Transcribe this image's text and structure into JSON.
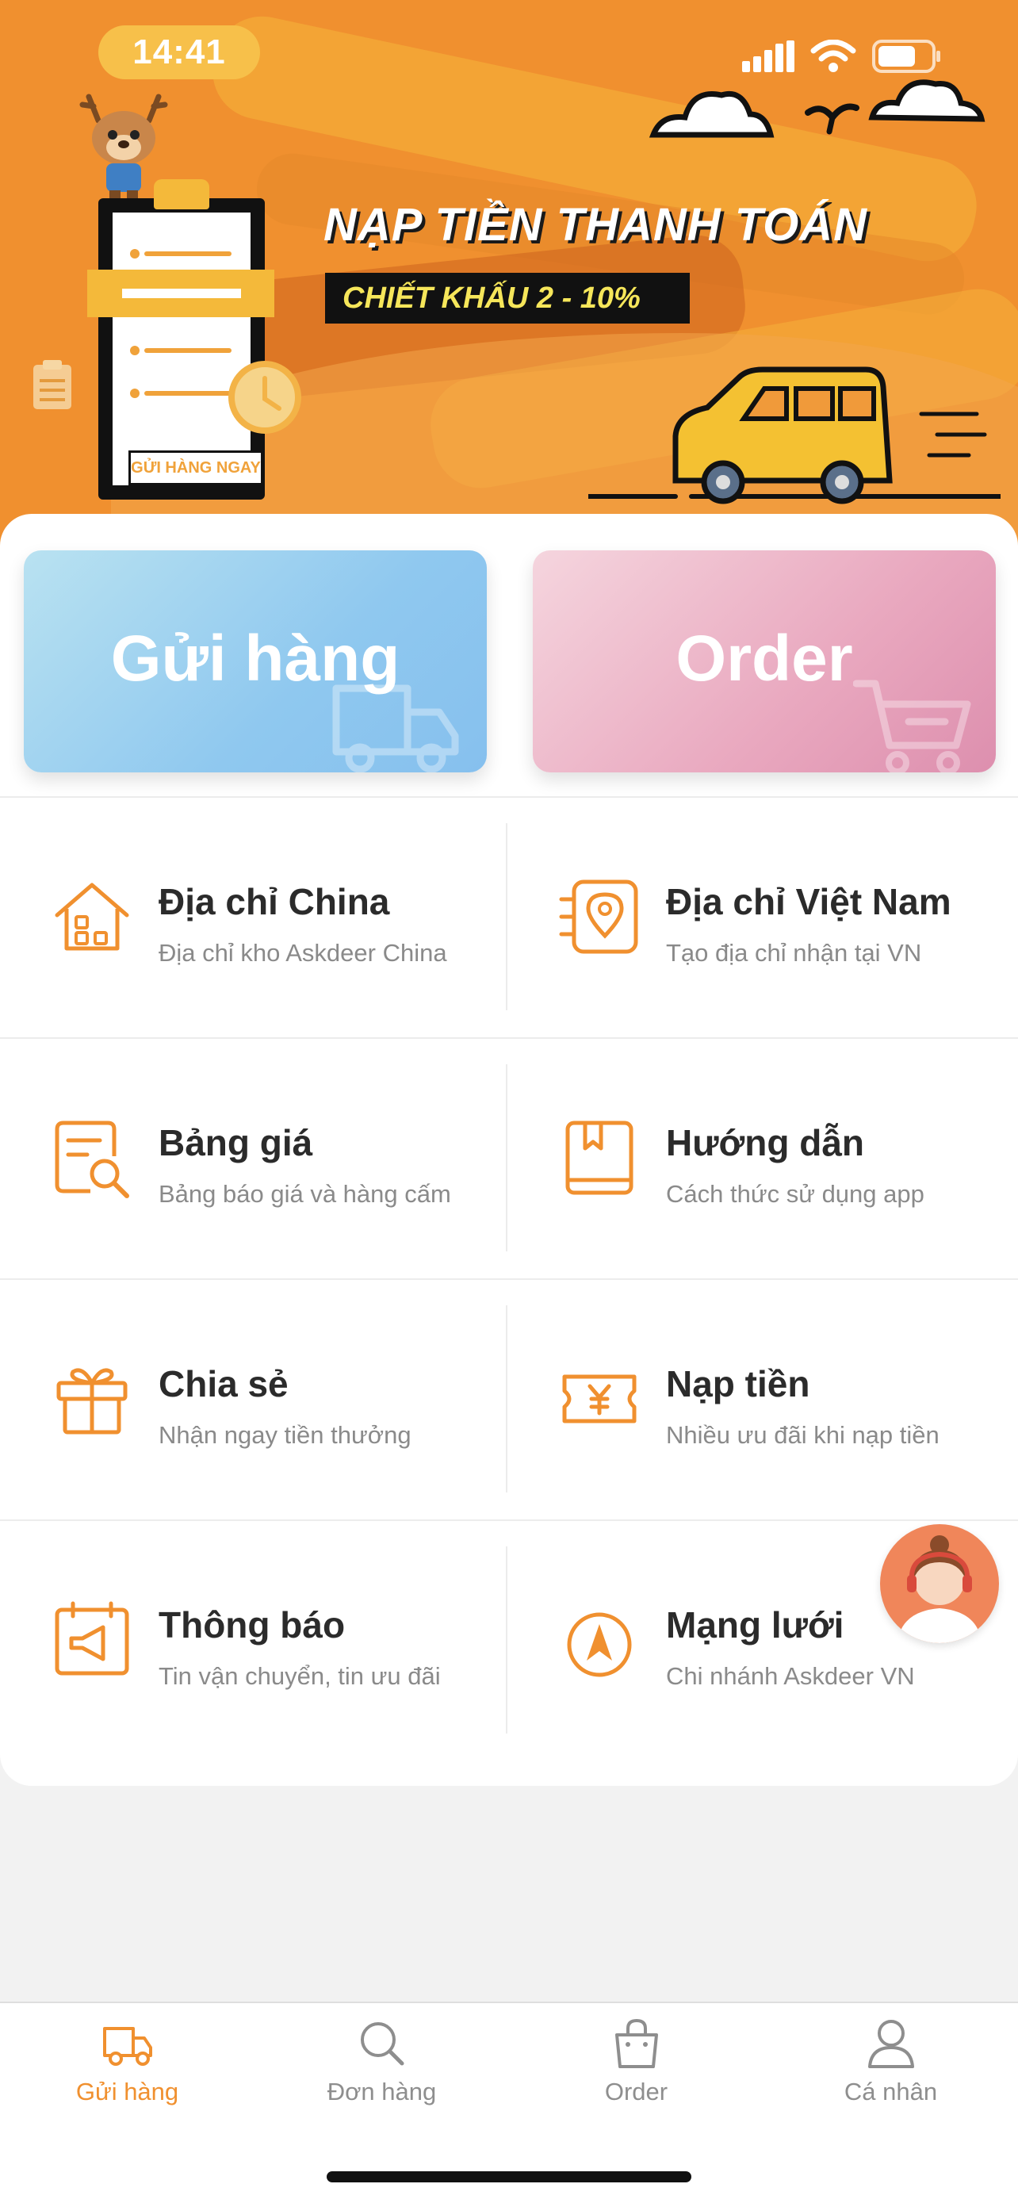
{
  "status_bar": {
    "time": "14:41"
  },
  "banner": {
    "title": "NẠP TIỀN THANH TOÁN",
    "subtitle": "CHIẾT KHẤU 2 - 10%",
    "cta": "GỬI HÀNG NGAY"
  },
  "actions": {
    "ship_label": "Gửi hàng",
    "order_label": "Order"
  },
  "grid": [
    {
      "title": "Địa chỉ China",
      "subtitle": "Địa chỉ kho Askdeer China",
      "icon": "house-icon"
    },
    {
      "title": "Địa chỉ Việt Nam",
      "subtitle": "Tạo địa chỉ nhận tại VN",
      "icon": "location-pin-icon"
    },
    {
      "title": "Bảng giá",
      "subtitle": "Bảng báo giá và hàng cấm",
      "icon": "price-list-icon"
    },
    {
      "title": "Hướng dẫn",
      "subtitle": "Cách thức sử dụng app",
      "icon": "guide-book-icon"
    },
    {
      "title": "Chia sẻ",
      "subtitle": "Nhận ngay tiền thưởng",
      "icon": "gift-icon"
    },
    {
      "title": "Nạp tiền",
      "subtitle": "Nhiều ưu đãi khi nạp tiền",
      "icon": "yen-ticket-icon"
    },
    {
      "title": "Thông báo",
      "subtitle": "Tin vận chuyển, tin ưu đãi",
      "icon": "megaphone-icon"
    },
    {
      "title": "Mạng lưới",
      "subtitle": "Chi nhánh Askdeer VN",
      "icon": "navigation-icon"
    }
  ],
  "tabs": [
    {
      "label": "Gửi hàng",
      "icon": "truck-icon",
      "active": true
    },
    {
      "label": "Đơn hàng",
      "icon": "search-icon",
      "active": false
    },
    {
      "label": "Order",
      "icon": "shopping-bag-icon",
      "active": false
    },
    {
      "label": "Cá nhân",
      "icon": "person-icon",
      "active": false
    }
  ],
  "colors": {
    "accent": "#f0902f",
    "ship_button": "#8fc8ef",
    "order_button": "#e9a8bf",
    "text": "#2b2b2b",
    "muted": "#8a8a8a"
  }
}
